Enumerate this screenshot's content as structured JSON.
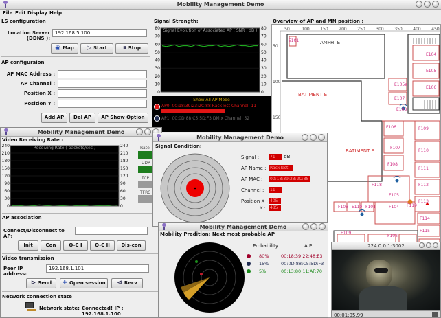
{
  "main_window": {
    "title": "Mobility Management Demo",
    "menu": [
      "File",
      "Edit",
      "Display",
      "Help"
    ]
  },
  "ls_config": {
    "heading": "LS configuration",
    "server_label": "Location Server (DDNS ):",
    "server_value": "192.168.5.100",
    "map_btn": "Map",
    "start_btn": "Start",
    "stop_btn": "Stop"
  },
  "ap_config": {
    "heading": "AP configuraion",
    "mac_label": "AP MAC Address :",
    "channel_label": "AP  Channel :",
    "posx_label": "Position X :",
    "posy_label": "Position Y :",
    "add_btn": "Add AP",
    "del_btn": "Del AP",
    "show_btn": "AP Show Option"
  },
  "signal_strength": {
    "heading": "Signal Strength:",
    "subtitle": "Signal Evolution of Associated AP ( SNR : dB )",
    "y_ticks_left": [
      "80",
      "70",
      "60",
      "50",
      "40",
      "30",
      "20",
      "10",
      "0"
    ],
    "y_ticks_right": [
      "80",
      "70",
      "60",
      "50",
      "40",
      "30",
      "20",
      "10",
      "0"
    ],
    "show_all_label": "Show All AP Mode",
    "ap0_text": "AP0: 00:18:39:23:2C:88  RackTest  Channel: 11",
    "ap1_text": "AP1: 00:0D:88:C5:5D:F3  DMIx  Channel: 52",
    "colors": {
      "series": "#22c022",
      "ap0": "#e01515",
      "show_all": "#d7a800"
    }
  },
  "overview": {
    "heading": "Overview of AP and MN position :",
    "x_ticks": [
      "50",
      "100",
      "150",
      "200",
      "250",
      "300",
      "350",
      "400",
      "450"
    ],
    "y_ticks": [
      "50",
      "100",
      "150",
      "200",
      "250"
    ],
    "labels": {
      "amphi": "AMPHI E",
      "batiment_e": "BATIMENT E",
      "batiment_f": "BATIMENT F"
    },
    "rooms": [
      "E101",
      "E104",
      "E105",
      "E105a",
      "E106",
      "E107",
      "E108",
      "E109",
      "E110",
      "F101",
      "F102",
      "F103",
      "F104",
      "F105",
      "F106",
      "F107",
      "F108",
      "F109",
      "F110",
      "F111",
      "F112",
      "F113",
      "F114",
      "F115",
      "F116",
      "F117",
      "F117a",
      "F118",
      "F119",
      "F120",
      "F121",
      "F122",
      "F123",
      "F124",
      "F125"
    ]
  },
  "video_window": {
    "title": "Mobility Management Demo",
    "video_rate_heading": "Video Receiving Rate :",
    "chart_subtitle": "Receiving Rate ( packets/sec )",
    "rate_label": "Rate",
    "udp_label": "UDP",
    "tcp_label": "TCP",
    "tfrc_label": "TFRC",
    "ap_assoc_heading": "AP association",
    "connect_label": "Connect/Disconnect to AP:",
    "init_btn": "Init",
    "con_btn": "Con",
    "qci_btn": "Q-C I",
    "qcii_btn": "Q-C II",
    "discon_btn": "Dis-con",
    "video_tx_heading": "Video transmission",
    "peer_label": "Peer IP address:",
    "peer_value": "192.168.1.101",
    "send_btn": "Send",
    "open_btn": "Open session",
    "recv_btn": "Recv",
    "net_heading": "Network connection state",
    "net_label": "Network state:",
    "net_value": "Connected!  IP : 192.168.1.100"
  },
  "chart_data": [
    {
      "type": "line",
      "title": "Signal Evolution of Associated AP ( SNR : dB )",
      "ylim": [
        0,
        80
      ],
      "series": [
        {
          "name": "AP0",
          "values": [
            58,
            57,
            58,
            59,
            57,
            58,
            58,
            57,
            59,
            58,
            57,
            58,
            58,
            59,
            57,
            58,
            57,
            58,
            59,
            58,
            58,
            57,
            58,
            58
          ]
        }
      ]
    },
    {
      "type": "line",
      "title": "Receiving Rate ( packets/sec )",
      "ylim": [
        0,
        240
      ],
      "y_ticks": [
        "240",
        "210",
        "180",
        "150",
        "120",
        "90",
        "60",
        "30",
        "0"
      ],
      "series": [
        {
          "name": "UDP",
          "values": [
            2,
            3,
            2,
            4,
            3,
            2,
            5,
            3,
            2,
            4,
            3,
            2,
            3,
            4,
            2,
            3,
            2,
            4,
            3,
            2,
            3,
            2,
            4,
            3
          ]
        }
      ]
    }
  ],
  "signal_window": {
    "title": "Mobility Management Demo",
    "heading": "Signal Condition:",
    "signal_label": "Signal :",
    "signal_value": "71",
    "signal_unit": "dB",
    "apname_label": "AP Name :",
    "apname_value": "RackTest",
    "apmac_label": "AP MAC :",
    "apmac_value": "00:18:39:23:2C:88",
    "channel_label": "Channel :",
    "channel_value": "11",
    "posx_label": "Position X :",
    "posx_value": "405",
    "posy_label": "Y :",
    "posy_value": "485"
  },
  "prediction_window": {
    "title": "Mobility Management Demo",
    "heading": "Mobility Predition: Next most probable AP",
    "prob_header": "Probability",
    "ap_header": "A P",
    "rows": [
      {
        "prob": "80%",
        "ap": "00:18:39:22:48:E3",
        "color": "#a0002a"
      },
      {
        "prob": "15%",
        "ap": "00:0D:88:C5:5D:F3",
        "color": "#1e2a50"
      },
      {
        "prob": "5%",
        "ap": "00:13:80:11:AF:70",
        "color": "#1b8a1b"
      }
    ]
  },
  "video_player": {
    "title": "224.0.0.1:3002",
    "time": "00:01:05.99"
  }
}
